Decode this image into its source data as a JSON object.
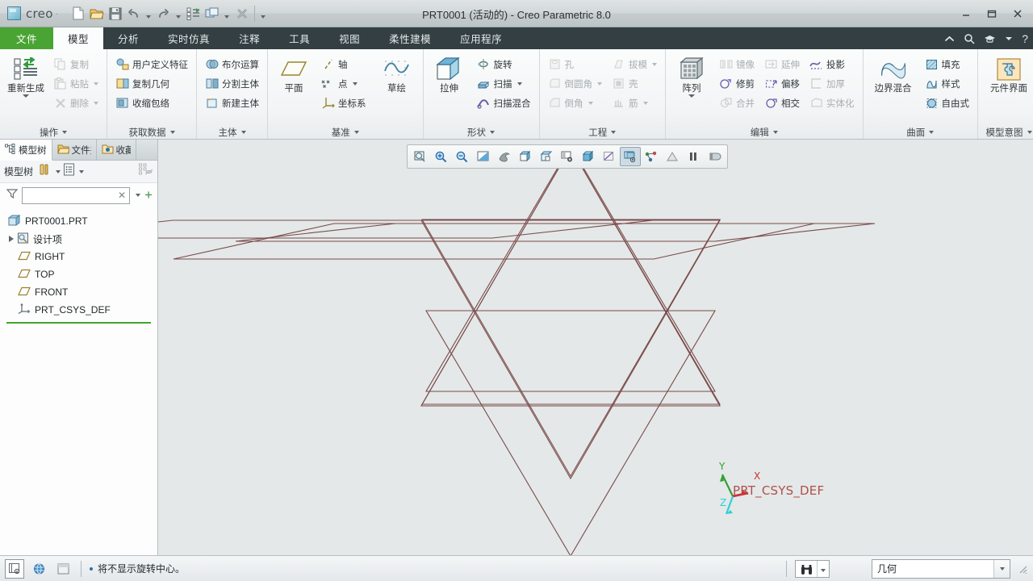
{
  "window": {
    "title": "PRT0001 (活动的) - Creo Parametric 8.0",
    "logo_text": "creo",
    "minimize": "–",
    "maximize": "❐",
    "close": "✕"
  },
  "quick_access": [
    {
      "name": "new-file-icon",
      "label": "新建"
    },
    {
      "name": "open-file-icon",
      "label": "打开"
    },
    {
      "name": "save-icon",
      "label": "保存"
    },
    {
      "name": "undo-icon",
      "label": "撤销"
    },
    {
      "name": "redo-icon",
      "label": "重做"
    },
    {
      "name": "regenerate-icon",
      "label": "重新生成"
    },
    {
      "name": "window-switch-icon",
      "label": "窗口"
    },
    {
      "name": "close-window-icon",
      "label": "关闭"
    }
  ],
  "tabs": [
    {
      "label": "文件",
      "active": false,
      "file": true
    },
    {
      "label": "模型",
      "active": true
    },
    {
      "label": "分析",
      "active": false
    },
    {
      "label": "实时仿真",
      "active": false
    },
    {
      "label": "注释",
      "active": false
    },
    {
      "label": "工具",
      "active": false
    },
    {
      "label": "视图",
      "active": false
    },
    {
      "label": "柔性建模",
      "active": false
    },
    {
      "label": "应用程序",
      "active": false
    }
  ],
  "tab_right_icons": [
    {
      "name": "collapse-ribbon-icon",
      "glyph": "⌃"
    },
    {
      "name": "search-icon",
      "glyph": "⚲"
    },
    {
      "name": "learning-icon",
      "glyph": "✐"
    },
    {
      "name": "chevron-down-icon",
      "glyph": "▾"
    },
    {
      "name": "help-icon",
      "glyph": "?"
    }
  ],
  "ribbon": {
    "groups": [
      {
        "title": "操作",
        "big": {
          "label": "重新生成",
          "icon": "regenerate-icon",
          "has_dropdown": true
        },
        "items": [
          {
            "label": "复制",
            "icon": "copy-icon",
            "disabled": true
          },
          {
            "label": "粘贴",
            "icon": "paste-icon",
            "disabled": true,
            "dropdown": true
          },
          {
            "label": "删除",
            "icon": "delete-icon",
            "disabled": true,
            "dropdown": true
          }
        ]
      },
      {
        "title": "获取数据",
        "items": [
          {
            "label": "用户定义特征",
            "icon": "udf-icon"
          },
          {
            "label": "复制几何",
            "icon": "copy-geometry-icon"
          },
          {
            "label": "收缩包络",
            "icon": "shrinkwrap-icon"
          }
        ]
      },
      {
        "title": "主体",
        "items": [
          {
            "label": "布尔运算",
            "icon": "boolean-icon"
          },
          {
            "label": "分割主体",
            "icon": "split-body-icon"
          },
          {
            "label": "新建主体",
            "icon": "new-body-icon"
          }
        ]
      },
      {
        "title": "基准",
        "big": {
          "label": "平面",
          "icon": "datum-plane-icon"
        },
        "items": [
          {
            "label": "轴",
            "icon": "datum-axis-icon"
          },
          {
            "label": "点",
            "icon": "datum-point-icon",
            "dropdown": true
          },
          {
            "label": "坐标系",
            "icon": "datum-csys-icon"
          }
        ],
        "big2": {
          "label": "草绘",
          "icon": "sketch-icon"
        }
      },
      {
        "title": "形状",
        "big": {
          "label": "拉伸",
          "icon": "extrude-icon"
        },
        "items": [
          {
            "label": "旋转",
            "icon": "revolve-icon"
          },
          {
            "label": "扫描",
            "icon": "sweep-icon",
            "dropdown": true
          },
          {
            "label": "扫描混合",
            "icon": "swept-blend-icon"
          }
        ]
      },
      {
        "title": "工程",
        "items": [
          {
            "label": "孔",
            "icon": "hole-icon",
            "disabled": true
          },
          {
            "label": "倒圆角",
            "icon": "round-icon",
            "disabled": true,
            "dropdown": true
          },
          {
            "label": "倒角",
            "icon": "chamfer-icon",
            "disabled": true,
            "dropdown": true
          }
        ],
        "items2": [
          {
            "label": "拔模",
            "icon": "draft-icon",
            "disabled": true,
            "dropdown": true
          },
          {
            "label": "壳",
            "icon": "shell-icon",
            "disabled": true
          },
          {
            "label": "筋",
            "icon": "rib-icon",
            "disabled": true,
            "dropdown": true
          }
        ]
      },
      {
        "title": "编辑",
        "big": {
          "label": "阵列",
          "icon": "pattern-icon",
          "has_dropdown": true
        },
        "items": [
          {
            "label": "镜像",
            "icon": "mirror-icon",
            "disabled": true
          },
          {
            "label": "修剪",
            "icon": "trim-icon"
          },
          {
            "label": "合并",
            "icon": "merge-icon",
            "disabled": true
          }
        ],
        "items2": [
          {
            "label": "延伸",
            "icon": "extend-icon",
            "disabled": true
          },
          {
            "label": "偏移",
            "icon": "offset-icon"
          },
          {
            "label": "相交",
            "icon": "intersect-icon"
          }
        ],
        "items3": [
          {
            "label": "投影",
            "icon": "project-icon"
          },
          {
            "label": "加厚",
            "icon": "thicken-icon",
            "disabled": true
          },
          {
            "label": "实体化",
            "icon": "solidify-icon",
            "disabled": true
          }
        ]
      },
      {
        "title": "曲面",
        "big": {
          "label": "边界混合",
          "icon": "boundary-blend-icon"
        },
        "items": [
          {
            "label": "填充",
            "icon": "fill-icon"
          },
          {
            "label": "样式",
            "icon": "style-icon"
          },
          {
            "label": "自由式",
            "icon": "freestyle-icon"
          }
        ]
      },
      {
        "title": "模型意图",
        "big": {
          "label": "元件界面",
          "icon": "component-interface-icon"
        }
      }
    ]
  },
  "sidebar": {
    "tabs": [
      {
        "label": "模型树",
        "icon": "model-tree-icon",
        "active": true
      },
      {
        "label": "文件夹浏览器",
        "icon": "folder-browser-icon",
        "active": false
      },
      {
        "label": "收藏夹",
        "icon": "favorites-icon",
        "active": false
      }
    ],
    "toolbar": {
      "title": "模型树",
      "buttons": [
        {
          "name": "tree-settings-icon",
          "dropdown": true
        },
        {
          "name": "tree-columns-icon",
          "dropdown": true
        },
        {
          "name": "tree-filter-display-icon",
          "dropdown": false
        }
      ]
    },
    "filter": {
      "placeholder": "",
      "value": "",
      "clear_label": "✕",
      "add_label": "+"
    },
    "tree": [
      {
        "label": "PRT0001.PRT",
        "icon": "part-icon",
        "level": 0,
        "expander": false
      },
      {
        "label": "设计项",
        "icon": "design-items-icon",
        "level": 1,
        "expander": true
      },
      {
        "label": "RIGHT",
        "icon": "datum-plane-icon",
        "level": 1,
        "expander": false
      },
      {
        "label": "TOP",
        "icon": "datum-plane-icon",
        "level": 1,
        "expander": false
      },
      {
        "label": "FRONT",
        "icon": "datum-plane-icon",
        "level": 1,
        "expander": false
      },
      {
        "label": "PRT_CSYS_DEF",
        "icon": "datum-csys-icon",
        "level": 1,
        "expander": false
      }
    ]
  },
  "graphics_toolbar": [
    {
      "name": "refit-icon",
      "active": false
    },
    {
      "name": "zoom-in-icon",
      "active": false
    },
    {
      "name": "zoom-out-icon",
      "active": false
    },
    {
      "name": "repaint-icon",
      "active": false
    },
    {
      "name": "spin-center-icon",
      "active": false
    },
    {
      "name": "saved-orientations-icon",
      "active": false
    },
    {
      "name": "view-manager-icon",
      "active": false
    },
    {
      "name": "named-view-icon",
      "active": false
    },
    {
      "name": "display-style-icon",
      "active": false
    },
    {
      "name": "perspective-icon",
      "active": false
    },
    {
      "name": "datum-display-filters-icon",
      "active": true
    },
    {
      "name": "annotation-display-icon",
      "active": false
    },
    {
      "name": "spin-center-toggle-icon",
      "active": false
    },
    {
      "name": "pause-icon",
      "active": false
    },
    {
      "name": "resume-icon",
      "active": false
    }
  ],
  "viewport": {
    "background_color": "#e4e8e8",
    "wireframe_color": "#7a4a4a",
    "csys_label": "PRT_CSYS_DEF",
    "axes": [
      {
        "label": "X",
        "color": "#cc3333"
      },
      {
        "label": "Y",
        "color": "#33a033"
      },
      {
        "label": "Z",
        "color": "#2fd0d6"
      }
    ]
  },
  "statusbar": {
    "left_icons": [
      {
        "name": "selection-filter-icon"
      },
      {
        "name": "globe-icon"
      },
      {
        "name": "display-pane-icon"
      }
    ],
    "message": "将不显示旋转中心。",
    "find_icon": "binoculars-icon",
    "selection_filter_value": "几何"
  }
}
